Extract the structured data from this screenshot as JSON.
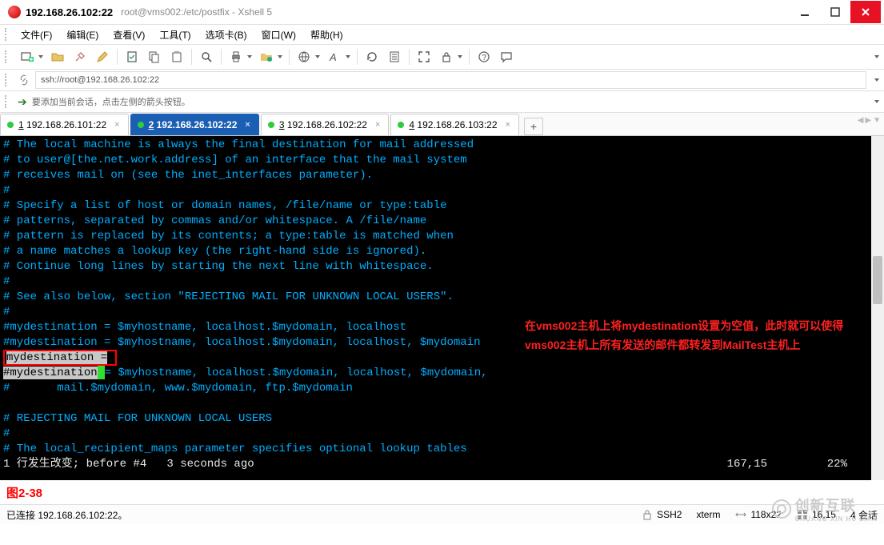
{
  "window": {
    "title_main": "192.168.26.102:22",
    "title_sub": "root@vms002:/etc/postfix - Xshell 5"
  },
  "menu": {
    "file": "文件(F)",
    "edit": "编辑(E)",
    "view": "查看(V)",
    "tools": "工具(T)",
    "tabs": "选项卡(B)",
    "window": "窗口(W)",
    "help": "帮助(H)"
  },
  "address": {
    "url": "ssh://root@192.168.26.102:22"
  },
  "hint": {
    "text": "要添加当前会话，点击左侧的箭头按钮。"
  },
  "tabs": [
    {
      "index": "1",
      "label": "192.168.26.101:22",
      "active": false
    },
    {
      "index": "2",
      "label": "192.168.26.102:22",
      "active": true
    },
    {
      "index": "3",
      "label": "192.168.26.102:22",
      "active": false
    },
    {
      "index": "4",
      "label": "192.168.26.103:22",
      "active": false
    }
  ],
  "terminal": {
    "lines": [
      "# The local machine is always the final destination for mail addressed",
      "# to user@[the.net.work.address] of an interface that the mail system",
      "# receives mail on (see the inet_interfaces parameter).",
      "#",
      "# Specify a list of host or domain names, /file/name or type:table",
      "# patterns, separated by commas and/or whitespace. A /file/name",
      "# pattern is replaced by its contents; a type:table is matched when",
      "# a name matches a lookup key (the right-hand side is ignored).",
      "# Continue long lines by starting the next line with whitespace.",
      "#",
      "# See also below, section \"REJECTING MAIL FOR UNKNOWN LOCAL USERS\".",
      "#",
      "#mydestination = $myhostname, localhost.$mydomain, localhost",
      "#mydestination = $myhostname, localhost.$mydomain, localhost, $mydomain"
    ],
    "highlight_line": "mydestination =",
    "after_lines_a": "#mydestination",
    "after_lines_b": "= $myhostname, localhost.$mydomain, localhost, $mydomain,",
    "after_lines_c": "#       mail.$mydomain, www.$mydomain, ftp.$mydomain",
    "blank": "",
    "reject_lines": [
      "# REJECTING MAIL FOR UNKNOWN LOCAL USERS",
      "#",
      "# The local_recipient_maps parameter specifies optional lookup tables"
    ],
    "status_line_left": "1 行发生改变; before #4   3 seconds ago",
    "status_line_pos": "167,15",
    "status_line_pct": "22%"
  },
  "annotation": {
    "text": "在vms002主机上将mydestination设置为空值，此时就可以使得vms002主机上所有发送的邮件都转发到MailTest主机上"
  },
  "caption": {
    "text": "图2-38"
  },
  "status": {
    "connected": "已连接 192.168.26.102:22。",
    "proto": "SSH2",
    "term": "xterm",
    "size": "118x22",
    "cursor": "16,15",
    "sessions": "4 会话"
  },
  "watermark": {
    "main": "创新互联",
    "sub": "CHUANG XIN HU LIAN"
  },
  "icons": {
    "minimize": "minimize-icon",
    "maximize": "maximize-icon",
    "close": "close-icon"
  }
}
